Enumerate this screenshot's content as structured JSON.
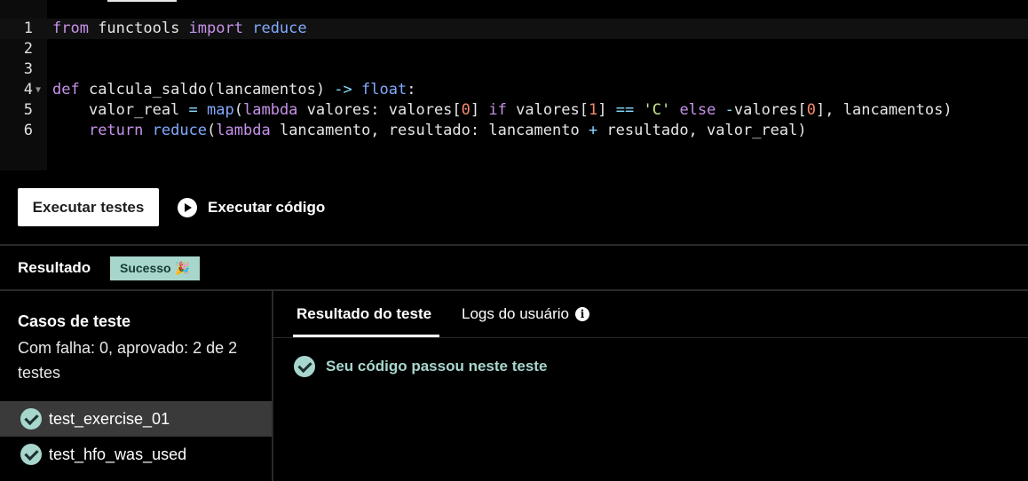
{
  "editor": {
    "lines": [
      {
        "number": "1",
        "tokens": [
          {
            "t": "from",
            "c": "kw"
          },
          {
            "t": " functools ",
            "c": ""
          },
          {
            "t": "import",
            "c": "kw"
          },
          {
            "t": " ",
            "c": ""
          },
          {
            "t": "reduce",
            "c": "fn"
          }
        ]
      },
      {
        "number": "2",
        "tokens": []
      },
      {
        "number": "3",
        "tokens": []
      },
      {
        "number": "4",
        "fold": true,
        "tokens": [
          {
            "t": "def",
            "c": "kw"
          },
          {
            "t": " calcula_saldo(lancamentos) ",
            "c": ""
          },
          {
            "t": "->",
            "c": "op"
          },
          {
            "t": " ",
            "c": ""
          },
          {
            "t": "float",
            "c": "fn"
          },
          {
            "t": ":",
            "c": ""
          }
        ]
      },
      {
        "number": "5",
        "tokens": [
          {
            "t": "    valor_real ",
            "c": ""
          },
          {
            "t": "=",
            "c": "op"
          },
          {
            "t": " ",
            "c": ""
          },
          {
            "t": "map",
            "c": "fn"
          },
          {
            "t": "(",
            "c": ""
          },
          {
            "t": "lambda",
            "c": "kw"
          },
          {
            "t": " valores: valores[",
            "c": ""
          },
          {
            "t": "0",
            "c": "num"
          },
          {
            "t": "] ",
            "c": ""
          },
          {
            "t": "if",
            "c": "kw"
          },
          {
            "t": " valores[",
            "c": ""
          },
          {
            "t": "1",
            "c": "num"
          },
          {
            "t": "] ",
            "c": ""
          },
          {
            "t": "==",
            "c": "op"
          },
          {
            "t": " ",
            "c": ""
          },
          {
            "t": "'C'",
            "c": "str"
          },
          {
            "t": " ",
            "c": ""
          },
          {
            "t": "else",
            "c": "kw"
          },
          {
            "t": " ",
            "c": ""
          },
          {
            "t": "-",
            "c": "op"
          },
          {
            "t": "valores[",
            "c": ""
          },
          {
            "t": "0",
            "c": "num"
          },
          {
            "t": "], lancamentos)",
            "c": ""
          }
        ]
      },
      {
        "number": "6",
        "tokens": [
          {
            "t": "    ",
            "c": ""
          },
          {
            "t": "return",
            "c": "kw"
          },
          {
            "t": " ",
            "c": ""
          },
          {
            "t": "reduce",
            "c": "fn"
          },
          {
            "t": "(",
            "c": ""
          },
          {
            "t": "lambda",
            "c": "kw"
          },
          {
            "t": " lancamento, resultado: lancamento ",
            "c": ""
          },
          {
            "t": "+",
            "c": "op"
          },
          {
            "t": " resultado, valor_real)",
            "c": ""
          }
        ]
      }
    ]
  },
  "toolbar": {
    "run_tests_label": "Executar testes",
    "run_code_label": "Executar código",
    "run_code_icon": "play-circle-icon"
  },
  "result": {
    "label": "Resultado",
    "badge": "Sucesso 🎉",
    "badge_color": "#a7d6cd"
  },
  "test_cases": {
    "title": "Casos de teste",
    "summary": "Com falha: 0, aprovado: 2 de 2 testes",
    "items": [
      {
        "label": "test_exercise_01",
        "selected": true,
        "status_icon": "check-circle-icon"
      },
      {
        "label": "test_hfo_was_used",
        "selected": false,
        "status_icon": "check-circle-icon"
      }
    ]
  },
  "tabs": {
    "items": [
      {
        "label": "Resultado do teste",
        "active": true
      },
      {
        "label": "Logs do usuário",
        "active": false,
        "icon": "info-icon"
      }
    ],
    "info_glyph": "i"
  },
  "test_result": {
    "message": "Seu código passou neste teste",
    "icon": "check-circle-icon"
  }
}
